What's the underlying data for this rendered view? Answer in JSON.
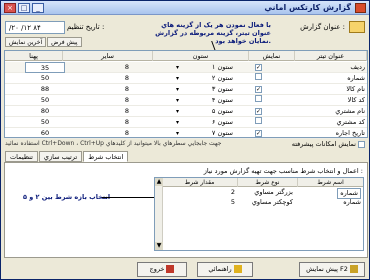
{
  "window": {
    "title": "گزارش کارتکس اماني",
    "close": "×",
    "max": "□",
    "min": "_"
  },
  "header": {
    "report_label": "عنوان گزارش :",
    "date_label": "تاريخ تنظيم :",
    "date_value": "/۲۰ /۱۲ ۸۴",
    "note": "با فعال نمودن هر يک از گزينه هاي عنوان تيتر، گزينه مربوطه در گزارش نمايان خواهد بود."
  },
  "top_tabs": [
    "آخرين نمايش",
    "پيش فرض"
  ],
  "grid": {
    "headers": [
      "پهنا",
      "ساير",
      "ستون",
      "نمايش",
      "عنوان تيتر"
    ],
    "rows": [
      {
        "title": "رديف",
        "col": "ستون ۱",
        "checked": true,
        "size": "8",
        "width": "35"
      },
      {
        "title": "شماره",
        "col": "ستون ۲",
        "checked": false,
        "size": "8",
        "width": "50"
      },
      {
        "title": "نام کالا",
        "col": "ستون ۳",
        "checked": true,
        "size": "8",
        "width": "88"
      },
      {
        "title": "کد کالا",
        "col": "ستون ۴",
        "checked": false,
        "size": "8",
        "width": "50"
      },
      {
        "title": "نام مشتري",
        "col": "ستون ۵",
        "checked": true,
        "size": "8",
        "width": "80"
      },
      {
        "title": "کد مشتري",
        "col": "ستون ۶",
        "checked": false,
        "size": "8",
        "width": "50"
      },
      {
        "title": "تاريخ اجاره",
        "col": "ستون ۷",
        "checked": true,
        "size": "8",
        "width": "60"
      }
    ]
  },
  "adv_label": "نمايش امکانات پيشرفته",
  "hint": "جهت جابجايي سطرهاي بالا ميتوانيد از کليدهاي Ctrl+Down ، Ctrl+Up استفاده نمائيد",
  "tabs": [
    "انتخاب شرط",
    "ترتيب سازي",
    "تنظيمات"
  ],
  "conditions": {
    "title": "اعمال و انتخاب شرط مناسب جهت تهيه گزارش مورد نياز :",
    "headers": [
      "اسم شرط",
      "نوع شرط",
      "مقدار شرط"
    ],
    "rows": [
      {
        "name": "شماره",
        "type": "بزرگتر مساوي",
        "value": "2"
      },
      {
        "name": "شماره",
        "type": "کوچکتر مساوي",
        "value": "5"
      }
    ],
    "annotation": "انتخاب بازه شرط بين ۲ و ۵"
  },
  "buttons": {
    "preview": "پيش نمايش F2",
    "exit": "خروج",
    "help": "راهنمائي"
  }
}
